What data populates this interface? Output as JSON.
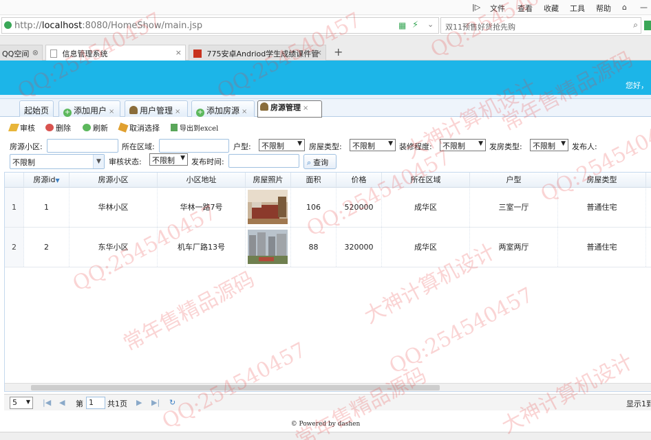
{
  "browser": {
    "menu": [
      "文件",
      "查看",
      "收藏",
      "工具",
      "帮助"
    ],
    "url_prefix": "http://",
    "url_host": "localhost",
    "url_rest": ":8080/HomeShow/main.jsp",
    "search_text": "双11预售好货抢先购",
    "tabs": [
      {
        "label": "QQ空间"
      },
      {
        "label": "信息管理系统"
      },
      {
        "label": "775安卓Andriod学生成绩课件管"
      }
    ],
    "new_tab": "+"
  },
  "header": {
    "greeting": "您好，"
  },
  "app_tabs": [
    {
      "label": "起始页",
      "closable": false
    },
    {
      "label": "添加用户",
      "closable": true,
      "icon": "add-icon"
    },
    {
      "label": "用户管理",
      "closable": true,
      "icon": "user-icon"
    },
    {
      "label": "添加房源",
      "closable": true,
      "icon": "add-icon"
    },
    {
      "label": "房源管理",
      "closable": true,
      "icon": "user-icon",
      "selected": true
    }
  ],
  "close_glyph": "×",
  "toolbar": {
    "audit": "审核",
    "delete": "删除",
    "refresh": "刷新",
    "cancel_select": "取消选择",
    "export": "导出到excel"
  },
  "filters": {
    "community_label": "房源小区:",
    "area_label": "所在区域:",
    "layout_label": "户型:",
    "layout_value": "不限制",
    "house_type_label": "房屋类型:",
    "house_type_value": "不限制",
    "decoration_label": "装修程度:",
    "decoration_value": "不限制",
    "listing_type_label": "发房类型:",
    "listing_type_value": "不限制",
    "publisher_label": "发布人:",
    "publisher_value": "不限制",
    "audit_label": "审核状态:",
    "audit_value": "不限制",
    "time_label": "发布时间:",
    "query_button": "查询"
  },
  "grid": {
    "columns": [
      "房源id",
      "房源小区",
      "小区地址",
      "房屋照片",
      "面积",
      "价格",
      "所在区域",
      "户型",
      "房屋类型"
    ],
    "rows": [
      {
        "num": "1",
        "id": "1",
        "community": "华林小区",
        "address": "华林一路7号",
        "photo": "bedroom",
        "area": "106",
        "price": "520000",
        "district": "成华区",
        "layout": "三室一厅",
        "type": "普通住宅"
      },
      {
        "num": "2",
        "id": "2",
        "community": "东华小区",
        "address": "机车厂路13号",
        "photo": "buildings",
        "area": "88",
        "price": "320000",
        "district": "成华区",
        "layout": "两室两厅",
        "type": "普通住宅"
      }
    ]
  },
  "pager": {
    "page_size": "5",
    "page_prefix": "第",
    "page_value": "1",
    "page_suffix": "共1页",
    "display_text": "显示1到"
  },
  "footer": "© Powered by dashen",
  "watermarks": [
    "QQ:254540457",
    "大神计算机设计",
    "常年售精品源码"
  ],
  "colors": {
    "header": "#1cb5e8",
    "watermark": "#e63c3c"
  }
}
